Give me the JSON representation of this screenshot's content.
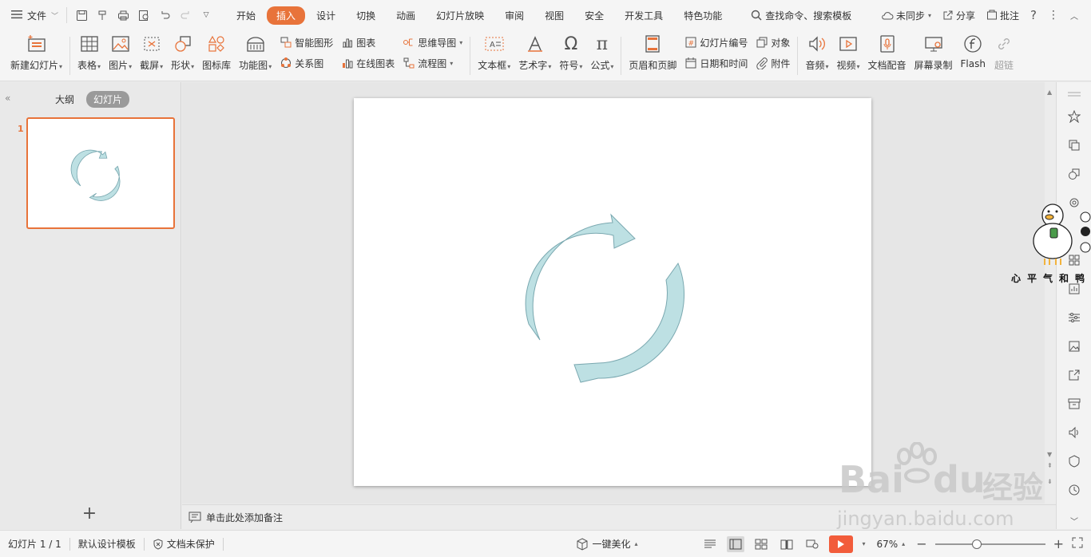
{
  "menubar": {
    "file_label": "文件",
    "tabs": [
      {
        "label": "开始",
        "active": false
      },
      {
        "label": "插入",
        "active": true
      },
      {
        "label": "设计",
        "active": false
      },
      {
        "label": "切换",
        "active": false
      },
      {
        "label": "动画",
        "active": false
      },
      {
        "label": "幻灯片放映",
        "active": false
      },
      {
        "label": "审阅",
        "active": false
      },
      {
        "label": "视图",
        "active": false
      },
      {
        "label": "安全",
        "active": false
      },
      {
        "label": "开发工具",
        "active": false
      },
      {
        "label": "特色功能",
        "active": false
      }
    ],
    "search_label": "查找命令、搜索模板",
    "sync_label": "未同步",
    "share_label": "分享",
    "comment_label": "批注"
  },
  "ribbon": {
    "new_slide": "新建幻灯片",
    "table": "表格",
    "picture": "图片",
    "screenshot": "截屏",
    "shape": "形状",
    "icon_lib": "图标库",
    "func_chart": "功能图",
    "smart_art": "智能图形",
    "chart": "图表",
    "relation": "关系图",
    "online_chart": "在线图表",
    "mind_map": "思维导图",
    "flowchart": "流程图",
    "textbox": "文本框",
    "wordart": "艺术字",
    "symbol": "符号",
    "formula": "公式",
    "header_footer": "页眉和页脚",
    "slide_number": "幻灯片编号",
    "object": "对象",
    "date_time": "日期和时间",
    "attachment": "附件",
    "audio": "音频",
    "video": "视频",
    "doc_dub": "文档配音",
    "screen_rec": "屏幕录制",
    "flash": "Flash",
    "hyperlink": "超链"
  },
  "leftpanel": {
    "outline_tab": "大纲",
    "slides_tab": "幻灯片",
    "slide_number": "1"
  },
  "notes": {
    "placeholder": "单击此处添加备注"
  },
  "statusbar": {
    "slide_pos": "幻灯片 1 / 1",
    "template": "默认设计模板",
    "protection": "文档未保护",
    "beautify": "一键美化",
    "zoom": "67%",
    "zoom_level": 0.38
  },
  "watermark": {
    "brand": "Bai",
    "brand2": "du",
    "cn": "经验",
    "url": "jingyan.baidu.com"
  },
  "sticker": {
    "caption": "心平气和鸭"
  },
  "colors": {
    "accent": "#e8733a",
    "arrow_fill": "#bde0e3",
    "arrow_stroke": "#7aa8b0",
    "play": "#f25c3b"
  }
}
